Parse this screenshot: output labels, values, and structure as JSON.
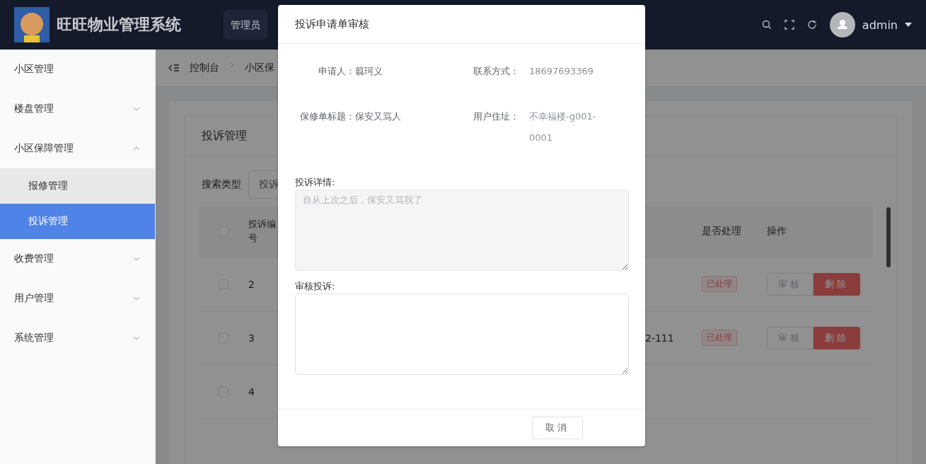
{
  "header": {
    "title": "旺旺物业管理系统",
    "tab": "管理员",
    "user": "admin"
  },
  "sidebar": {
    "items": [
      {
        "label": "小区管理",
        "kind": "leaf"
      },
      {
        "label": "楼盘管理",
        "kind": "group",
        "expanded": false
      },
      {
        "label": "小区保障管理",
        "kind": "group",
        "expanded": true,
        "children": [
          {
            "label": "报修管理",
            "selected": false,
            "highlighted": true
          },
          {
            "label": "投诉管理",
            "selected": true
          }
        ]
      },
      {
        "label": "收费管理",
        "kind": "group",
        "expanded": false
      },
      {
        "label": "用户管理",
        "kind": "group",
        "expanded": false
      },
      {
        "label": "系统管理",
        "kind": "group",
        "expanded": false
      }
    ]
  },
  "breadcrumb": [
    "控制台",
    "小区保"
  ],
  "card": {
    "title": "投诉管理",
    "search_label": "搜索类型",
    "search_type": "投诉"
  },
  "table": {
    "all_checked": false,
    "columns": [
      "投诉编号",
      "是否处理",
      "操作"
    ],
    "rows": [
      {
        "checked": false,
        "id": "2",
        "status": "已处理",
        "actions": [
          {
            "label": "审核",
            "kind": "plain"
          },
          {
            "label": "删除",
            "kind": "danger"
          }
        ]
      },
      {
        "checked": false,
        "id": "3",
        "column_3": "2-111",
        "status": "已处理",
        "actions": [
          {
            "label": "审核",
            "kind": "plain"
          },
          {
            "label": "删除",
            "kind": "danger"
          }
        ]
      },
      {
        "checked": false,
        "id": "4"
      }
    ]
  },
  "dialog": {
    "title": "投诉申请单审核",
    "fields": [
      {
        "label": "申请人：",
        "value": "翦珂义"
      },
      {
        "label": "联系方式：",
        "value": "18697693369"
      },
      {
        "label": "保修单标题：",
        "value": "保安又骂人"
      },
      {
        "label": "用户住址：",
        "value": "不幸福楼-g001-0001"
      }
    ],
    "details_label": "投诉详情:",
    "details": {
      "value": "自从上次之后，保安又骂我了",
      "disabled": true
    },
    "review_label": "审核投诉:",
    "cancel": "取消"
  }
}
